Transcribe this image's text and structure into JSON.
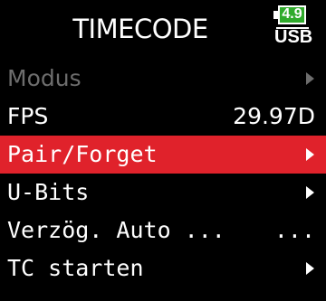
{
  "header": {
    "title": "TIMECODE",
    "battery_level": "4.9",
    "power_source": "USB",
    "battery_color": "#2faa2b"
  },
  "menu": {
    "accent_color": "#e0222b",
    "disabled_color": "#6d6d6d",
    "items": [
      {
        "label": "Modus",
        "value": "",
        "arrow": true,
        "state": "disabled"
      },
      {
        "label": "FPS",
        "value": "29.97D",
        "arrow": false,
        "state": "normal"
      },
      {
        "label": "Pair/Forget",
        "value": "",
        "arrow": true,
        "state": "selected"
      },
      {
        "label": "U-Bits",
        "value": "",
        "arrow": true,
        "state": "normal"
      },
      {
        "label": "Verzög. Auto ...",
        "value": "...",
        "arrow": false,
        "state": "normal"
      },
      {
        "label": "TC starten",
        "value": "",
        "arrow": true,
        "state": "normal"
      }
    ]
  }
}
